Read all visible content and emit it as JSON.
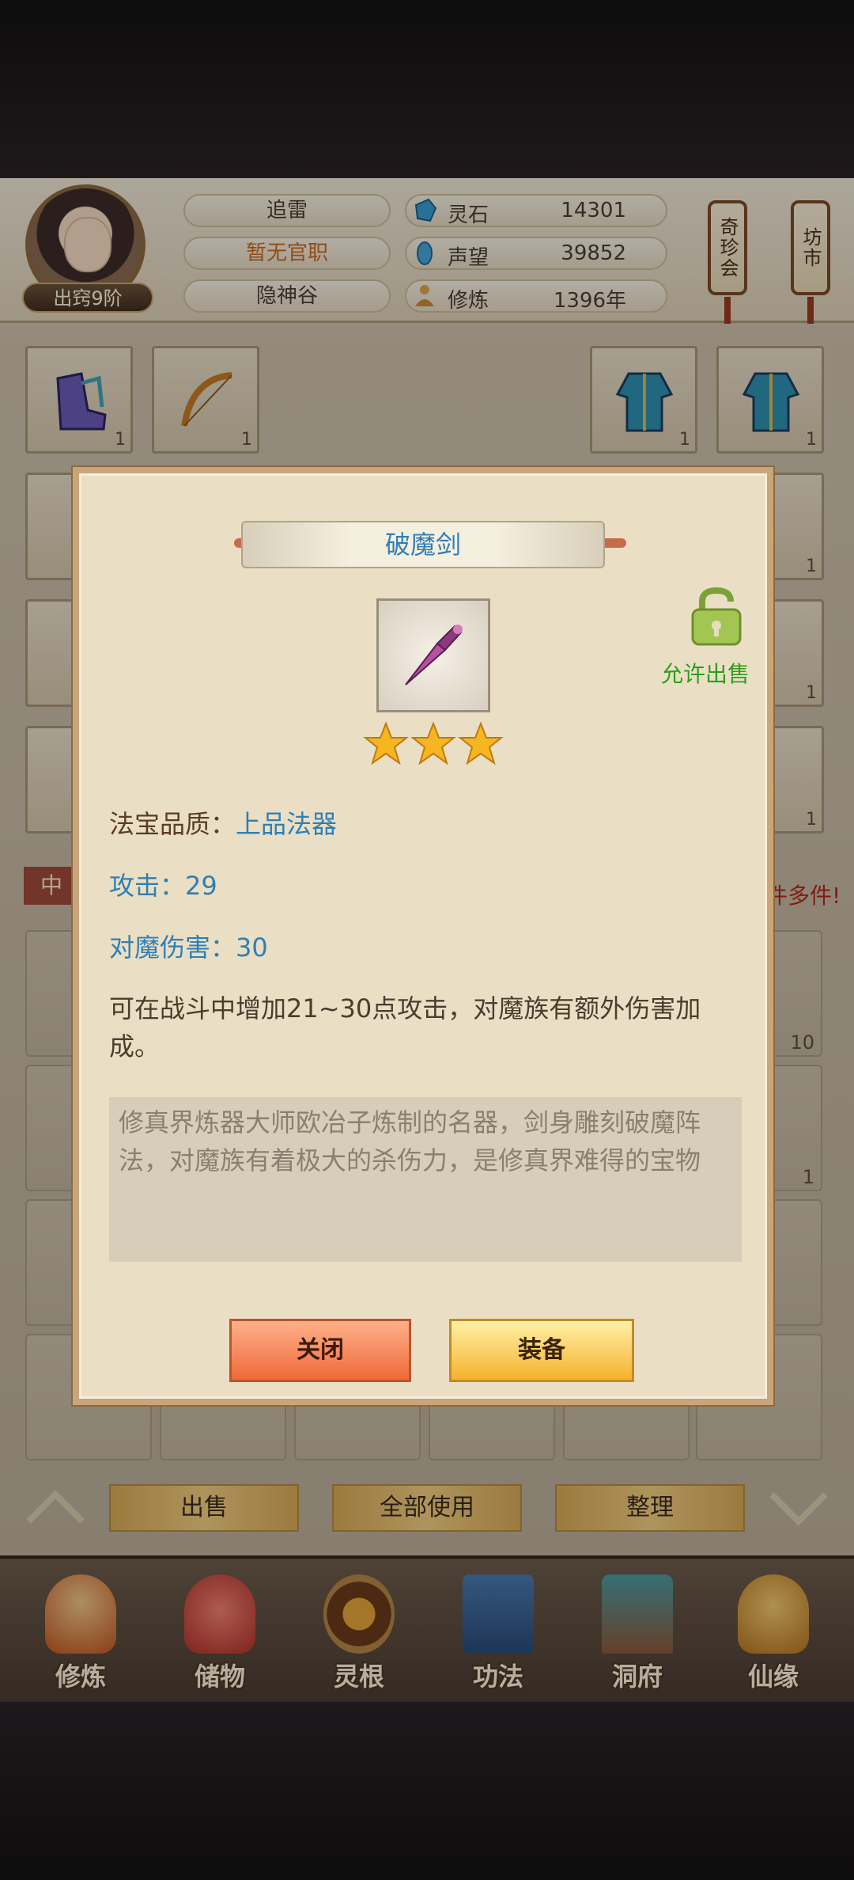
{
  "player": {
    "name": "追雷",
    "title": "暂无官职",
    "sect": "隐神谷",
    "rank": "出窍9阶"
  },
  "stats": [
    {
      "label": "灵石",
      "value": "14301",
      "icon": "spirit-stone-icon"
    },
    {
      "label": "声望",
      "value": "39852",
      "icon": "reputation-icon"
    },
    {
      "label": "修炼",
      "value": "1396年",
      "icon": "cultivation-icon"
    }
  ],
  "side_buttons": {
    "treasure": "奇珍会",
    "market": "坊市"
  },
  "inventory": {
    "top_slots": [
      {
        "item": "boots",
        "count": "1"
      },
      {
        "item": "bow",
        "count": "1"
      },
      {
        "item": "robe",
        "count": "1"
      },
      {
        "item": "robe",
        "count": "1"
      }
    ],
    "right_slots": [
      {
        "count": "1"
      },
      {
        "count": "1"
      },
      {
        "count": "1"
      }
    ],
    "lower_counts": [
      "10",
      "1"
    ],
    "partial_tag": "中",
    "partial_notice": "件多件!"
  },
  "actions": {
    "sell": "出售",
    "use_all": "全部使用",
    "sort": "整理"
  },
  "nav": [
    {
      "label": "修炼",
      "icon": "cultivation-nav-icon"
    },
    {
      "label": "储物",
      "icon": "storage-bag-icon"
    },
    {
      "label": "灵根",
      "icon": "spirit-root-icon"
    },
    {
      "label": "功法",
      "icon": "technique-book-icon"
    },
    {
      "label": "洞府",
      "icon": "cave-house-icon"
    },
    {
      "label": "仙缘",
      "icon": "immortal-fate-icon"
    }
  ],
  "dialog": {
    "item_name": "破魔剑",
    "stars": 3,
    "sell_status": "允许出售",
    "quality_label": "法宝品质：",
    "quality_value": "上品法器",
    "attack": "攻击：29",
    "demon_damage": "对魔伤害：30",
    "description": "可在战斗中增加21~30点攻击，对魔族有额外伤害加成。",
    "lore": "修真界炼器大师欧冶子炼制的名器，剑身雕刻破魔阵法，对魔族有着极大的杀伤力，是修真界难得的宝物",
    "close_label": "关闭",
    "equip_label": "装备"
  }
}
